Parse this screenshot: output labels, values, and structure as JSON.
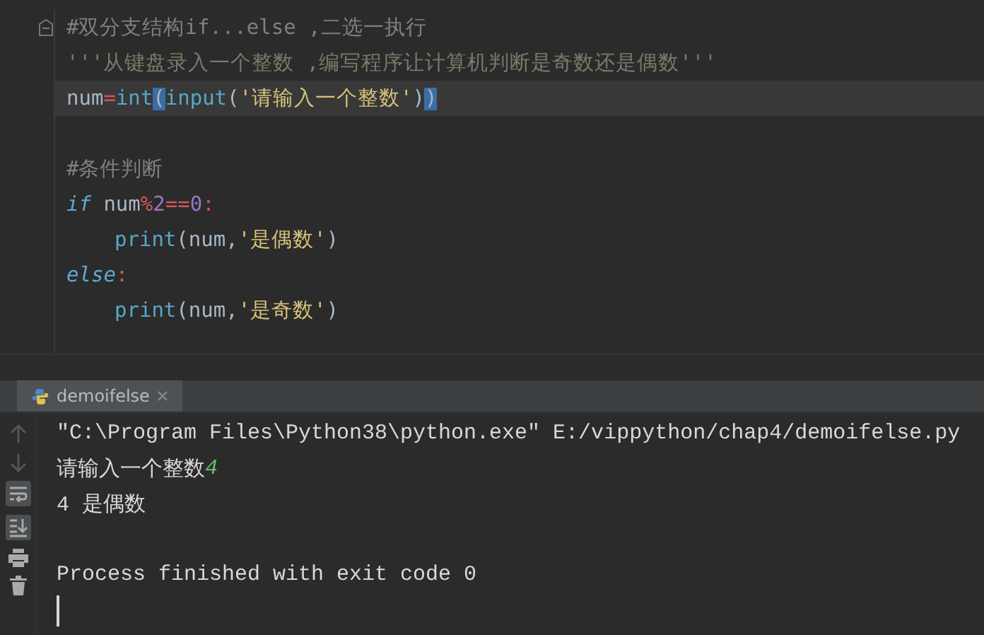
{
  "editor": {
    "lines": [
      {
        "kind": "fold_start",
        "current": false,
        "indented": false,
        "tokens": [
          {
            "kind": "comment",
            "text": "#双分支结构if...else ,二选一执行"
          }
        ]
      },
      {
        "kind": "code",
        "current": false,
        "indented": false,
        "tokens": [
          {
            "kind": "docstring",
            "text": "'''从键盘录入一个整数 ,编写程序让计算机判断是奇数还是偶数'''"
          }
        ]
      },
      {
        "kind": "code",
        "current": true,
        "indented": false,
        "tokens": [
          {
            "kind": "plain",
            "text": "num"
          },
          {
            "kind": "op",
            "text": "="
          },
          {
            "kind": "builtin",
            "text": "int"
          },
          {
            "kind": "paren",
            "text": "(",
            "matched": true
          },
          {
            "kind": "builtin",
            "text": "input"
          },
          {
            "kind": "plain",
            "text": "("
          },
          {
            "kind": "string",
            "text": "'请输入一个整数'"
          },
          {
            "kind": "plain",
            "text": ")"
          },
          {
            "kind": "paren",
            "text": ")",
            "matched": true
          }
        ]
      },
      {
        "kind": "blank"
      },
      {
        "kind": "code",
        "current": false,
        "indented": false,
        "tokens": [
          {
            "kind": "comment",
            "text": "#条件判断"
          }
        ]
      },
      {
        "kind": "code",
        "current": false,
        "indented": false,
        "tokens": [
          {
            "kind": "keyword",
            "text": "if"
          },
          {
            "kind": "plain",
            "text": " num"
          },
          {
            "kind": "op",
            "text": "%"
          },
          {
            "kind": "number",
            "text": "2"
          },
          {
            "kind": "op",
            "text": "=="
          },
          {
            "kind": "number",
            "text": "0"
          },
          {
            "kind": "op",
            "text": ":"
          }
        ]
      },
      {
        "kind": "code",
        "current": false,
        "indented": true,
        "tokens": [
          {
            "kind": "builtin",
            "text": "print"
          },
          {
            "kind": "plain",
            "text": "(num,"
          },
          {
            "kind": "string",
            "text": "'是偶数'"
          },
          {
            "kind": "plain",
            "text": ")"
          }
        ]
      },
      {
        "kind": "code",
        "current": false,
        "indented": false,
        "tokens": [
          {
            "kind": "keyword",
            "text": "else"
          },
          {
            "kind": "op",
            "text": ":"
          }
        ]
      },
      {
        "kind": "code",
        "current": false,
        "indented": true,
        "tokens": [
          {
            "kind": "builtin",
            "text": "print"
          },
          {
            "kind": "plain",
            "text": "(num,"
          },
          {
            "kind": "string",
            "text": "'是奇数'"
          },
          {
            "kind": "plain",
            "text": ")"
          }
        ]
      }
    ]
  },
  "run_panel": {
    "tab": {
      "label": "demoifelse",
      "selected": true
    },
    "output": [
      {
        "kind": "text",
        "parts": [
          {
            "kind": "stdout",
            "text": "\"C:\\Program Files\\Python38\\python.exe\" E:/vippython/chap4/demoifelse.py"
          }
        ]
      },
      {
        "kind": "text",
        "parts": [
          {
            "kind": "stdout",
            "text": "请输入一个整数"
          },
          {
            "kind": "input",
            "text": "4"
          }
        ]
      },
      {
        "kind": "text",
        "parts": [
          {
            "kind": "stdout",
            "text": "4 是偶数"
          }
        ]
      },
      {
        "kind": "blank"
      },
      {
        "kind": "text",
        "parts": [
          {
            "kind": "stdout",
            "text": "Process finished with exit code 0"
          }
        ]
      }
    ]
  }
}
